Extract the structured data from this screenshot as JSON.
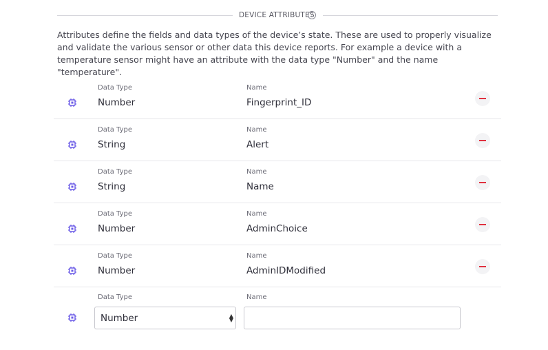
{
  "section": {
    "title": "DEVICE ATTRIBUTES",
    "help_glyph": "?",
    "description": "Attributes define the fields and data types of the device’s state. These are used to properly visualize and validate the various sensor or other data this device reports. For example a device with a temperature sensor might have an attribute with the data type \"Number\" and the name \"temperature\"."
  },
  "labels": {
    "data_type": "Data Type",
    "name": "Name"
  },
  "attributes": [
    {
      "type": "Number",
      "name": "Fingerprint_ID"
    },
    {
      "type": "String",
      "name": "Alert"
    },
    {
      "type": "String",
      "name": "Name"
    },
    {
      "type": "Number",
      "name": "AdminChoice"
    },
    {
      "type": "Number",
      "name": "AdminIDModified"
    }
  ],
  "new_attribute": {
    "type_selected": "Number",
    "name_value": "",
    "name_placeholder": ""
  },
  "colors": {
    "accent": "#6c5ce7",
    "remove": "#e0313f"
  },
  "icons": {
    "row_icon": "chip-icon",
    "remove_icon": "minus-icon",
    "help_icon": "help-circle-icon"
  }
}
